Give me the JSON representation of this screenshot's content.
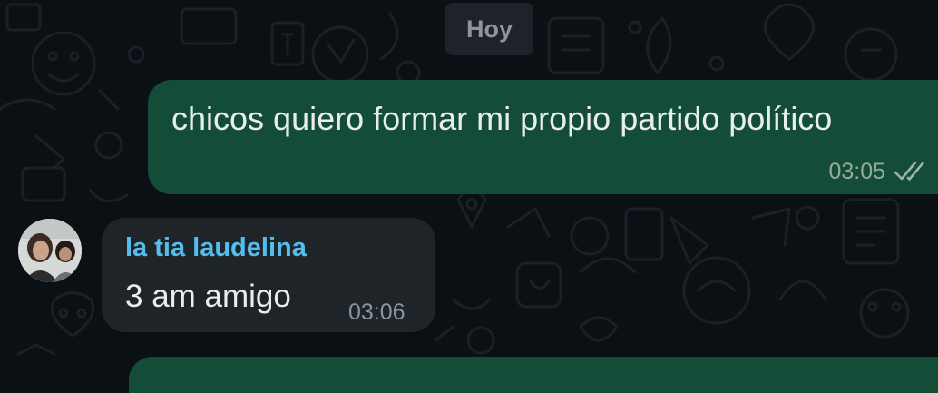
{
  "chat": {
    "date_separator": "Hoy",
    "messages": [
      {
        "direction": "outgoing",
        "text": "chicos quiero formar mi propio partido político",
        "time": "03:05",
        "status_icon": "double-check-icon"
      },
      {
        "direction": "incoming",
        "sender": "la tia laudelina",
        "text": "3 am amigo",
        "time": "03:06"
      }
    ]
  },
  "colors": {
    "background": "#0b1014",
    "outgoing_bubble": "#134d37",
    "incoming_bubble": "#1f2429",
    "sender_name": "#53bdeb",
    "date_chip": "#1d2328"
  }
}
